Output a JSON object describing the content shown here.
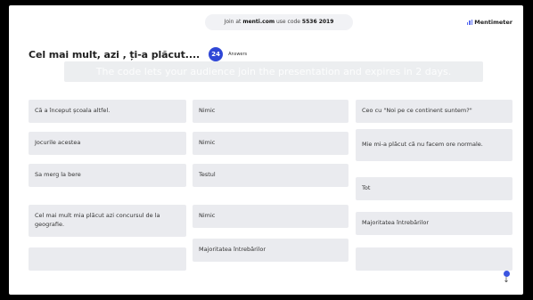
{
  "header": {
    "join_prefix": "Join at",
    "join_site": "menti.com",
    "join_mid": "use code",
    "join_code": "5536 2019",
    "brand": "Mentimeter"
  },
  "question": {
    "title": "Cel mai mult, azi , ți-a plăcut....",
    "answer_count": "24",
    "answer_label": "Answers"
  },
  "overlay_text": "The code lets your audience join the presentation and expires in 2 days.",
  "colors": {
    "accent": "#2f47d6",
    "card": "#eaebef",
    "frame": "#000000"
  },
  "columns": [
    [
      "Că a început școala altfel.",
      "Jocurile acestea",
      "Sa merg la bere",
      "Cel mai mult mia plăcut azi concursul de la geografie.",
      ""
    ],
    [
      "Nimic",
      "Nimic",
      "Testul",
      "Nimic",
      "Majoritatea întrebărilor"
    ],
    [
      "Ceo cu \"Noi pe ce continent suntem?\"",
      "Mie mi-a plăcut că nu facem ore normale.",
      "Tot",
      "Majoritatea întrebărilor",
      ""
    ]
  ],
  "icons": {
    "brand": "bar-chart-icon",
    "scroll": "scroll-down-icon"
  }
}
